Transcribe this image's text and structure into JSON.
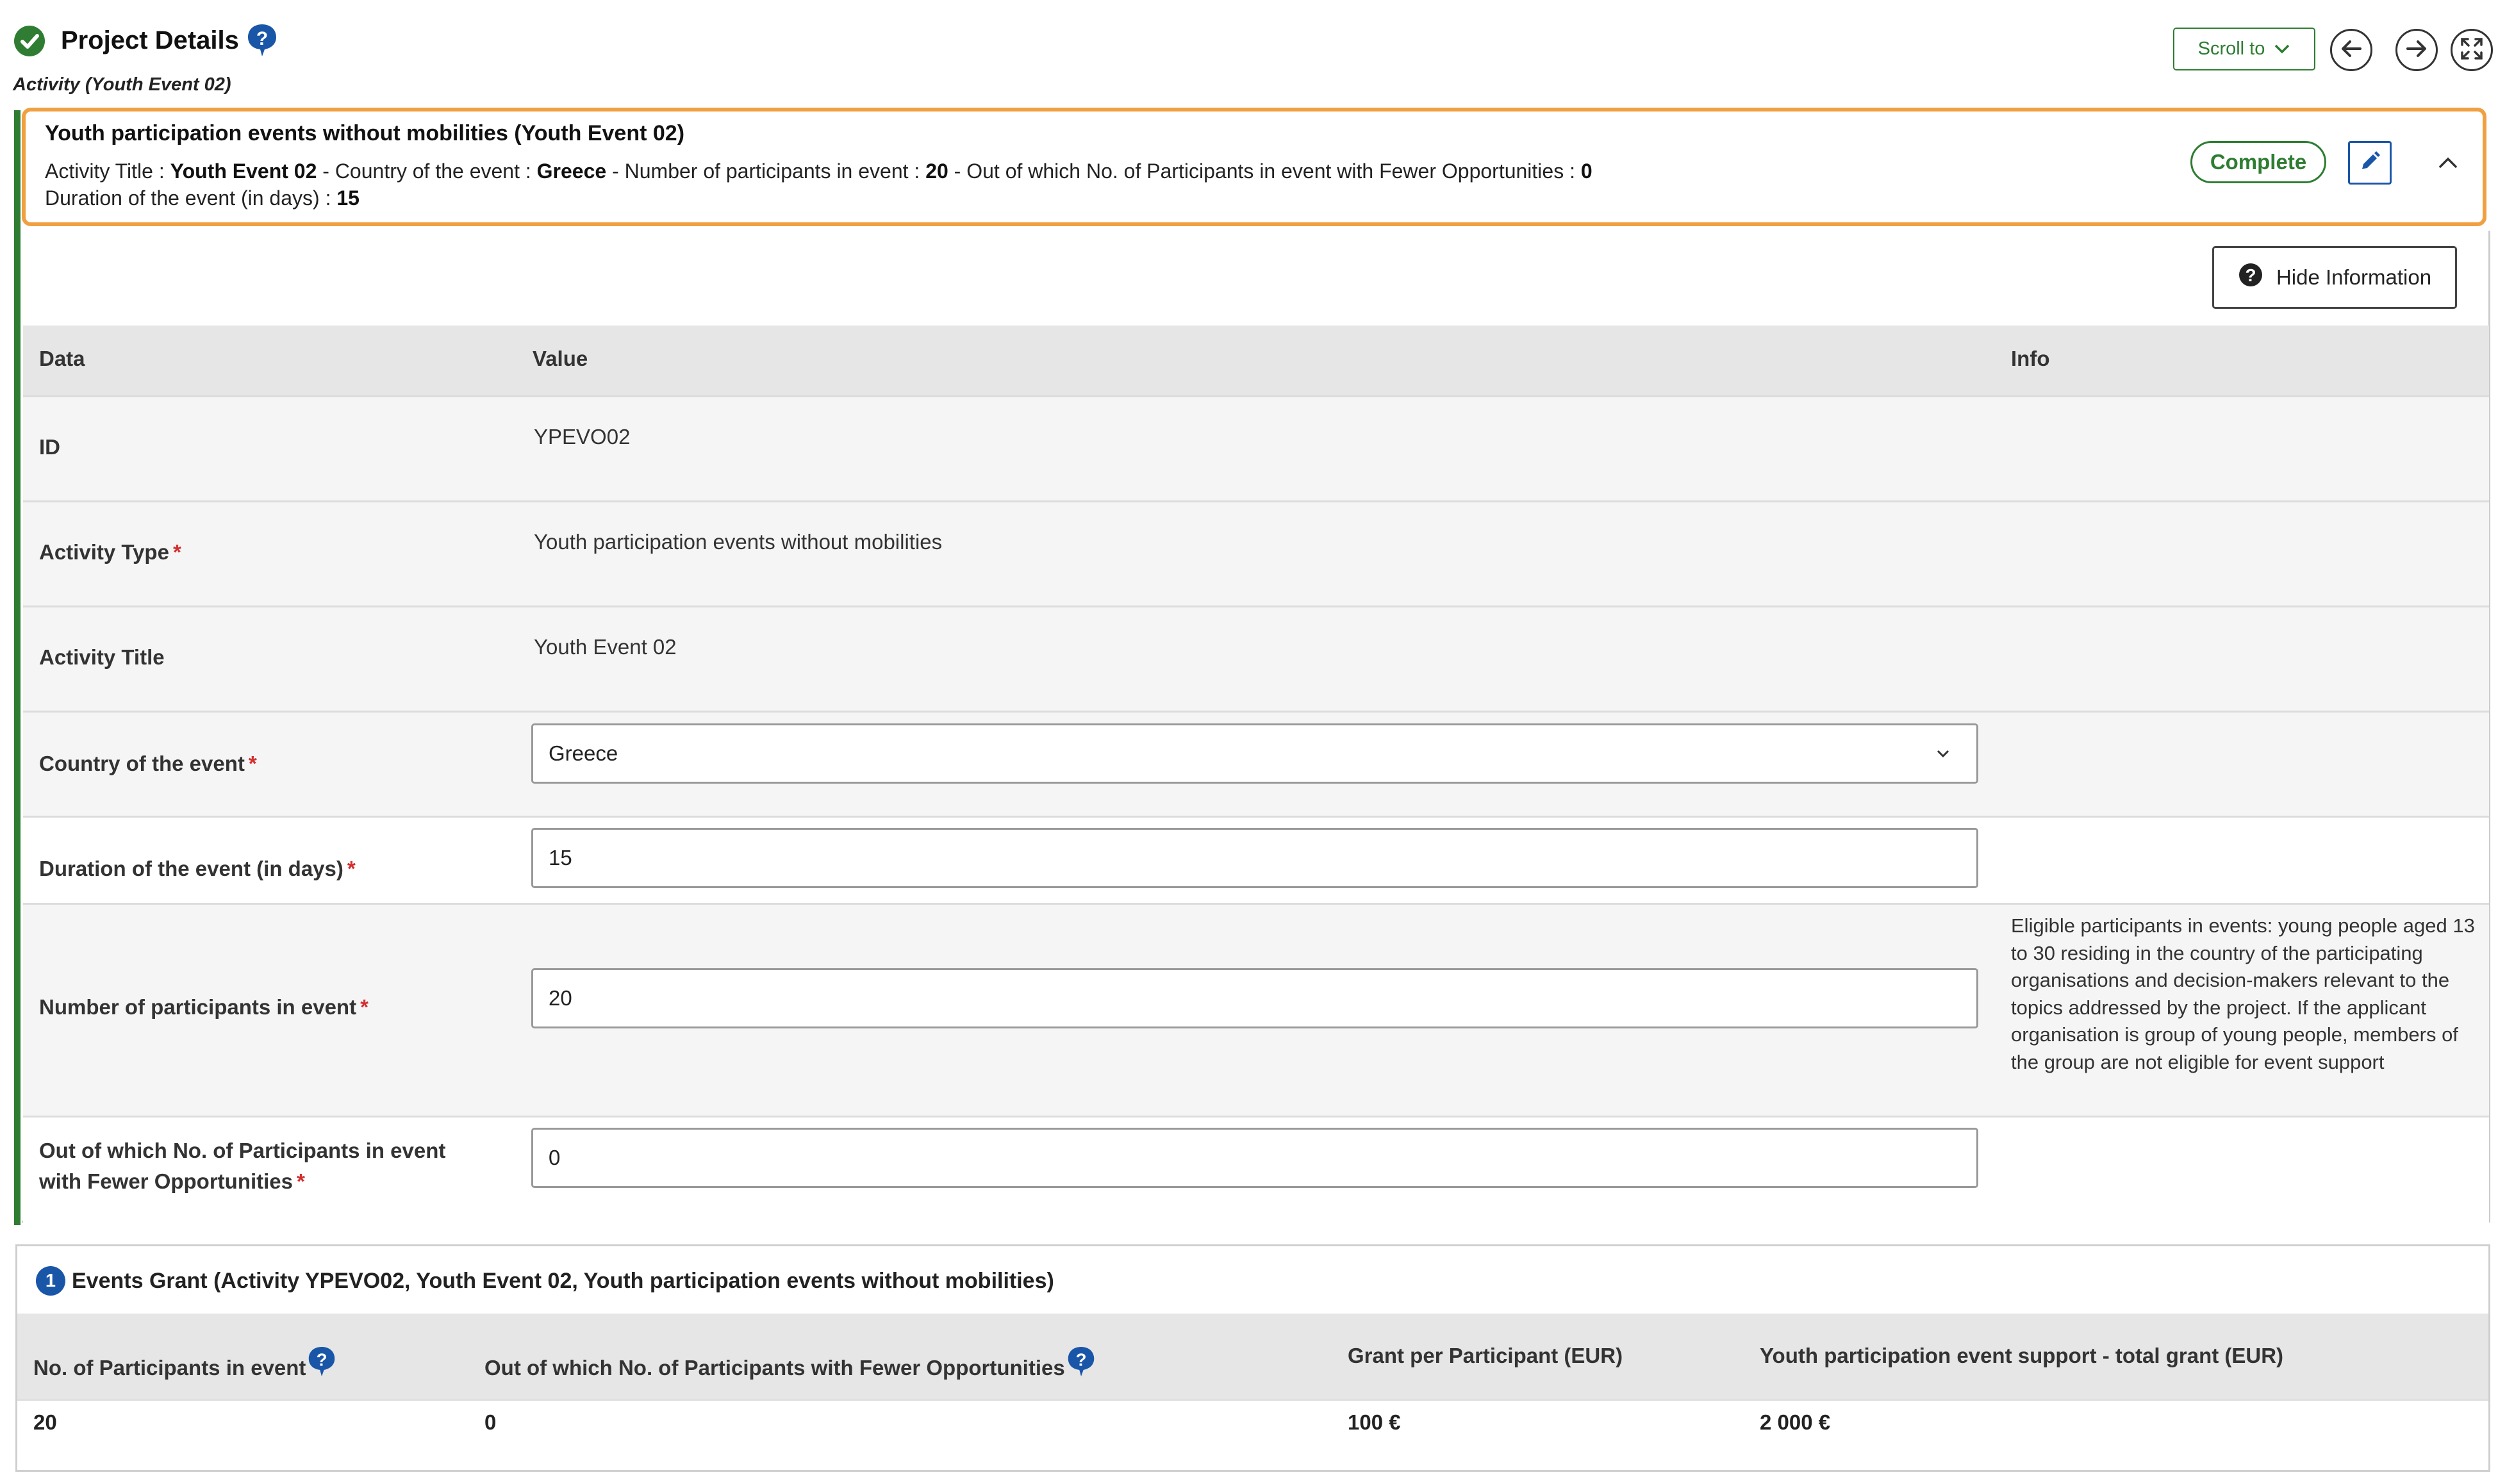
{
  "header": {
    "title": "Project Details",
    "subtitle": "Activity (Youth Event 02)",
    "scroll_to_label": "Scroll to",
    "icons": [
      "check-circle-icon",
      "help-icon",
      "chevron-down-icon",
      "arrow-left-icon",
      "arrow-right-icon",
      "fullscreen-icon"
    ]
  },
  "activity_card": {
    "title": "Youth participation events without mobilities (Youth Event 02)",
    "summary": {
      "activity_title_label": "Activity Title : ",
      "activity_title_value": "Youth Event 02",
      "country_label": " - Country of the event : ",
      "country_value": "Greece",
      "participants_label": " - Number of participants in event : ",
      "participants_value": "20",
      "fewer_opp_label": " - Out of which No. of Participants in event with Fewer Opportunities : ",
      "fewer_opp_value": "0",
      "duration_label": "Duration of the event (in days) : ",
      "duration_value": "15"
    },
    "status": "Complete",
    "colors": {
      "accent_green": "#2e7d32",
      "highlight_orange": "#f0a040",
      "blue": "#1a56a8",
      "required_red": "#d32f2f"
    }
  },
  "details": {
    "hide_info_label": "Hide Information",
    "columns": {
      "data": "Data",
      "value": "Value",
      "info": "Info"
    },
    "rows": {
      "id": {
        "label": "ID",
        "value": "YPEVO02"
      },
      "activity_type": {
        "label": "Activity Type",
        "required": "*",
        "value": "Youth participation events without mobilities"
      },
      "activity_title": {
        "label": "Activity Title",
        "value": "Youth Event 02"
      },
      "country": {
        "label": "Country of the event",
        "required": "*",
        "value": "Greece"
      },
      "duration": {
        "label": "Duration of the event (in days)",
        "required": "*",
        "value": "15"
      },
      "participants": {
        "label": "Number of participants in event",
        "required": "*",
        "value": "20",
        "info": "Eligible participants in events: young people aged 13 to 30 residing in the country of the participating organisations and decision-makers relevant to the topics addressed by the project. If the applicant organisation is group of young people, members of the group are not eligible for event support"
      },
      "fewer_opportunities": {
        "label_line1": "Out of which No. of Participants in event",
        "label_line2": "with Fewer Opportunities",
        "required": "*",
        "value": "0"
      }
    }
  },
  "grant": {
    "badge": "1",
    "title": "Events Grant (Activity YPEVO02, Youth Event 02, Youth participation events without mobilities)",
    "columns": {
      "participants": "No. of Participants in event",
      "fewer_opp": "Out of which No. of Participants with Fewer Opportunities",
      "grant_per_participant": "Grant per Participant (EUR)",
      "total_grant": "Youth participation event support - total grant (EUR)"
    },
    "row": {
      "participants": "20",
      "fewer_opp": "0",
      "grant_per_participant": "100 €",
      "total_grant": "2 000 €"
    }
  }
}
